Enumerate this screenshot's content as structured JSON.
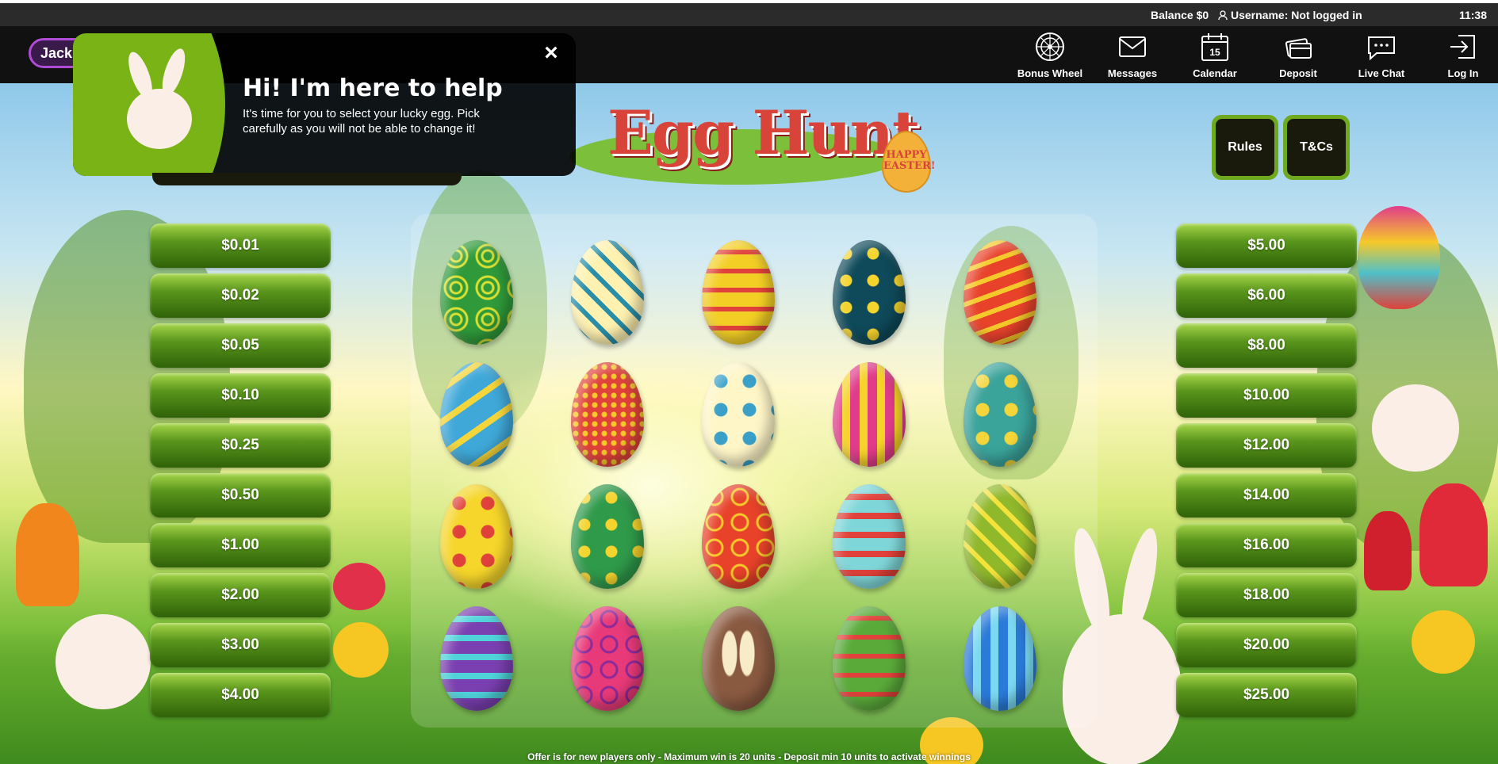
{
  "status_bar": {
    "balance": "Balance $0",
    "username": "Username: Not logged in",
    "time": "11:38"
  },
  "nav": {
    "logo_text": "Jackp",
    "items": [
      {
        "label": "Bonus Wheel",
        "icon": "wheel-icon"
      },
      {
        "label": "Messages",
        "icon": "envelope-icon"
      },
      {
        "label": "Calendar",
        "icon": "calendar-icon",
        "day": "15"
      },
      {
        "label": "Deposit",
        "icon": "cards-icon"
      },
      {
        "label": "Live Chat",
        "icon": "chat-icon"
      },
      {
        "label": "Log In",
        "icon": "login-icon"
      }
    ]
  },
  "popup": {
    "title": "Hi! I'm here to help",
    "message": "It's time for you to select your lucky egg. Pick carefully as you will not be able to change it!",
    "close_label": "×"
  },
  "game": {
    "title": "Egg Hunt",
    "badge_text": "HAPPY EASTER!",
    "rules_label": "Rules",
    "tcs_label": "T&Cs",
    "prizes_left": [
      "$0.01",
      "$0.02",
      "$0.05",
      "$0.10",
      "$0.25",
      "$0.50",
      "$1.00",
      "$2.00",
      "$3.00",
      "$4.00"
    ],
    "prizes_right": [
      "$5.00",
      "$6.00",
      "$8.00",
      "$10.00",
      "$12.00",
      "$14.00",
      "$16.00",
      "$18.00",
      "$20.00",
      "$25.00"
    ],
    "eggs": [
      {
        "pattern": "swirls",
        "colors": [
          "#2f9a3a",
          "#d8e032"
        ]
      },
      {
        "pattern": "lattice",
        "colors": [
          "#fff2b0",
          "#2a8ea8"
        ]
      },
      {
        "pattern": "bands",
        "colors": [
          "#f3cf25",
          "#e0413a"
        ]
      },
      {
        "pattern": "stars",
        "colors": [
          "#0f4a5a",
          "#f5d42e"
        ]
      },
      {
        "pattern": "zigzag",
        "colors": [
          "#e8422a",
          "#f6c92a"
        ]
      },
      {
        "pattern": "ribbons",
        "colors": [
          "#3fa8d8",
          "#f4d53a"
        ]
      },
      {
        "pattern": "dots",
        "colors": [
          "#e0413a",
          "#f6c92a"
        ]
      },
      {
        "pattern": "flowers",
        "colors": [
          "#fff6c8",
          "#3aa0c8"
        ]
      },
      {
        "pattern": "stripes",
        "colors": [
          "#e03c8a",
          "#f6d32a"
        ]
      },
      {
        "pattern": "flowers",
        "colors": [
          "#3aa39a",
          "#f4d53a"
        ]
      },
      {
        "pattern": "flowers",
        "colors": [
          "#f6d62a",
          "#e0413a"
        ]
      },
      {
        "pattern": "stars",
        "colors": [
          "#2f9a4a",
          "#f5d42e"
        ]
      },
      {
        "pattern": "hearts",
        "colors": [
          "#e8422a",
          "#f6c92a"
        ]
      },
      {
        "pattern": "waves",
        "colors": [
          "#7fd6d8",
          "#e0413a"
        ]
      },
      {
        "pattern": "lattice",
        "colors": [
          "#8fb82a",
          "#f2e23a"
        ]
      },
      {
        "pattern": "waves",
        "colors": [
          "#7a3fb0",
          "#4fd2d8"
        ]
      },
      {
        "pattern": "hearts",
        "colors": [
          "#e83a78",
          "#8a2a9a"
        ]
      },
      {
        "pattern": "bunny",
        "colors": [
          "#8a5a40",
          "#f8ecc8"
        ]
      },
      {
        "pattern": "bands",
        "colors": [
          "#5aaa3a",
          "#e0413a"
        ]
      },
      {
        "pattern": "stripes",
        "colors": [
          "#2a7ad8",
          "#7ad8f0"
        ]
      }
    ]
  },
  "footer": "Offer is for new players only - Maximum win is 20 units - Deposit min 10 units to activate winnings"
}
